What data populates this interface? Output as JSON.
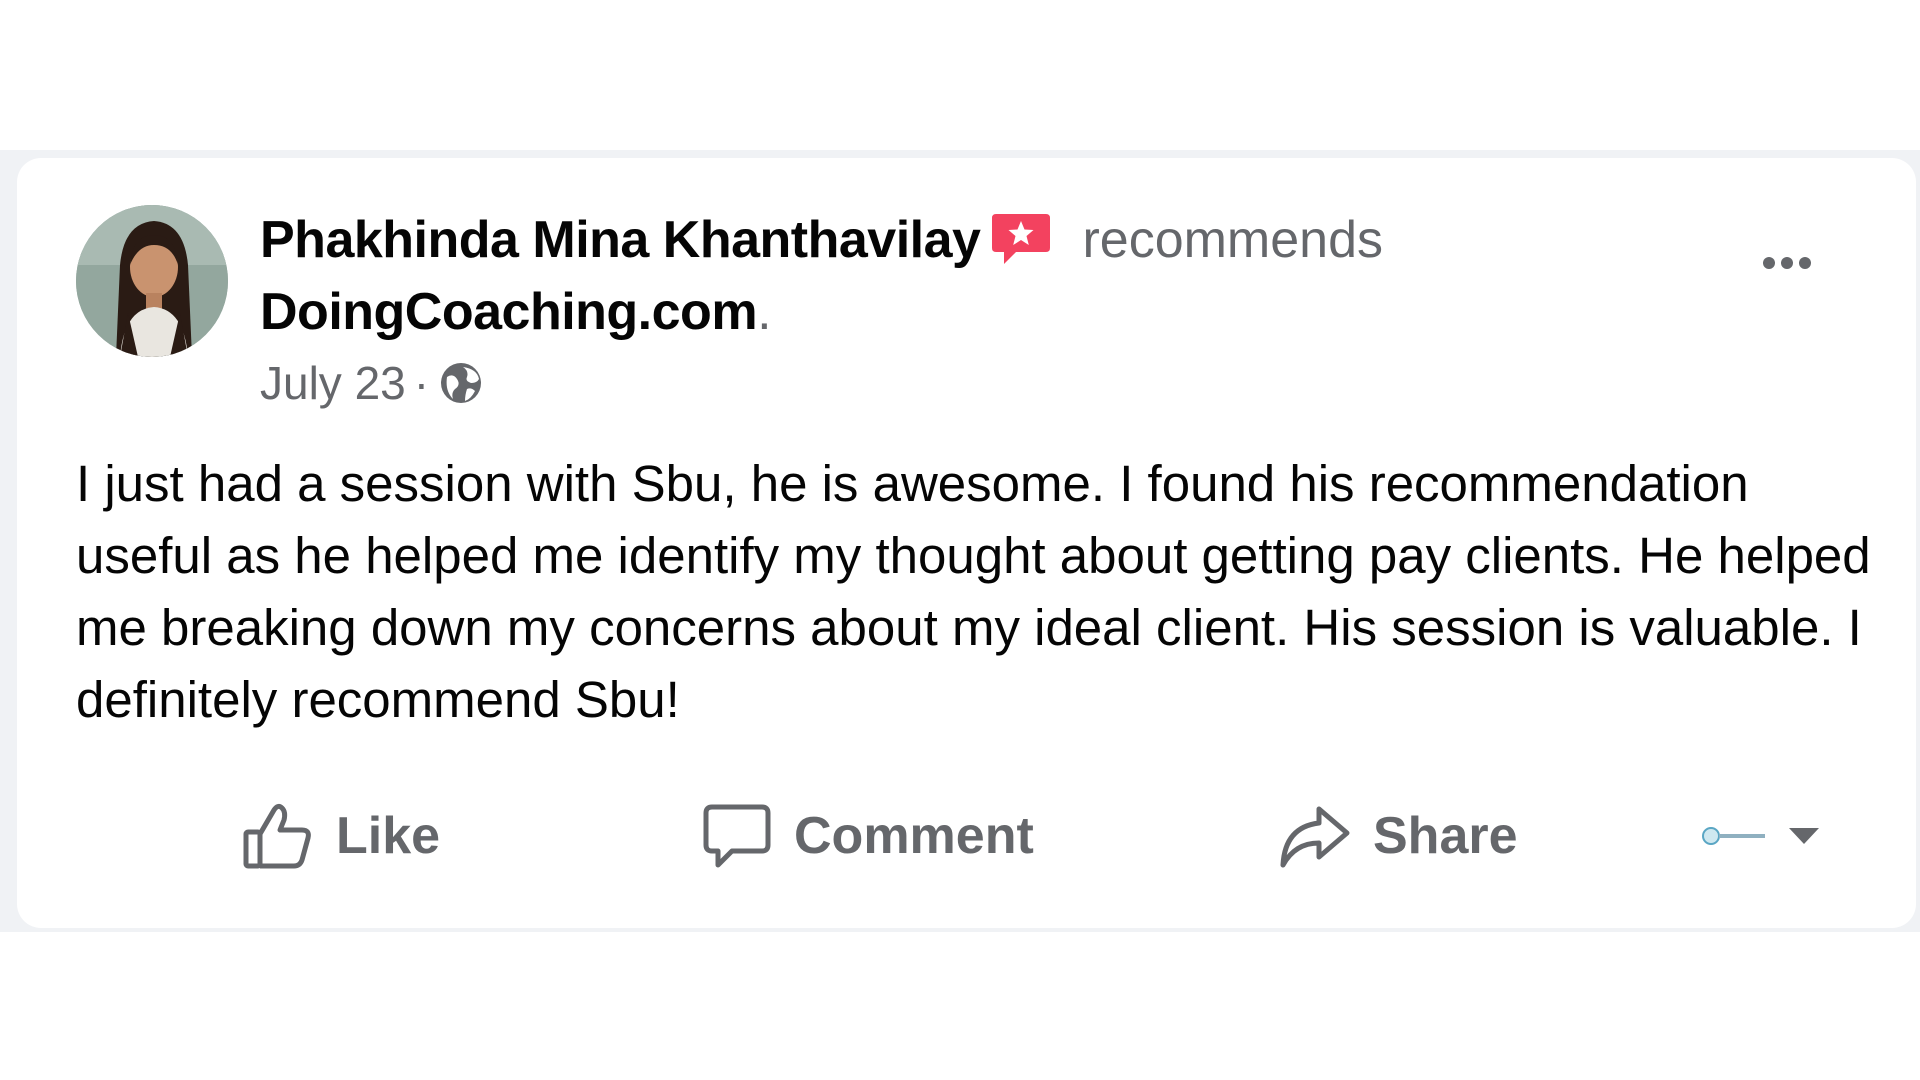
{
  "post": {
    "author": "Phakhinda Mina Khanthavilay",
    "verb": "recommends",
    "page": "DoingCoaching.com",
    "page_suffix": ".",
    "date": "July 23",
    "separator": "·",
    "privacy_icon": "globe-icon",
    "badge_icon": "star-recommendation-icon",
    "body": "I just had a session with Sbu, he is awesome. I found his recommendation useful as he helped me identify my thought about getting pay clients. He helped me breaking down my concerns about my ideal client. His session is valuable. I definitely recommend Sbu!"
  },
  "actions": {
    "like_label": "Like",
    "comment_label": "Comment",
    "share_label": "Share"
  },
  "colors": {
    "page_background": "#f0f2f5",
    "card": "#ffffff",
    "primary_text": "#050505",
    "secondary_text": "#65676b",
    "badge": "#f3425f"
  }
}
